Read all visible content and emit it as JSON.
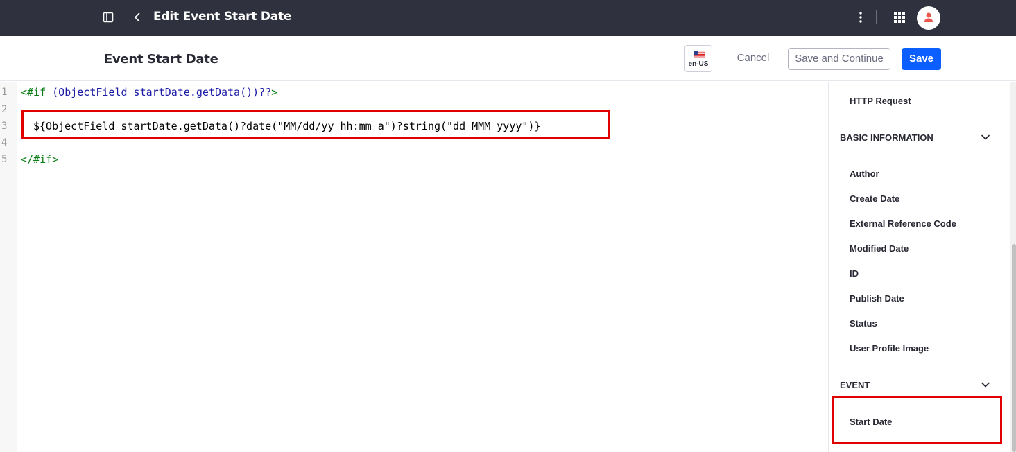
{
  "topbar": {
    "title": "Edit Event Start Date",
    "icons": [
      "sidebar-toggle-icon",
      "chevron-left-icon",
      "kebab-icon",
      "apps-grid-icon",
      "user-avatar-icon"
    ]
  },
  "header": {
    "page_title": "Event Start Date",
    "language_label": "en-US",
    "cancel_label": "Cancel",
    "save_continue_label": "Save and Continue",
    "save_label": "Save"
  },
  "editor": {
    "line_numbers": [
      "1",
      "2",
      "3",
      "4",
      "5"
    ],
    "lines": {
      "l1_tag": "<#if ",
      "l1_expr": "(ObjectField_startDate.getData())??",
      "l1_close": ">",
      "l3": "${ObjectField_startDate.getData()?date(\"MM/dd/yy hh:mm a\")?string(\"dd MMM yyyy\")}",
      "l5": "</#if>"
    }
  },
  "panel": {
    "http_request": "HTTP Request",
    "basic_information": {
      "heading": "BASIC INFORMATION",
      "items": [
        "Author",
        "Create Date",
        "External Reference Code",
        "Modified Date",
        "ID",
        "Publish Date",
        "Status",
        "User Profile Image"
      ]
    },
    "event": {
      "heading": "EVENT",
      "items": [
        "Start Date"
      ]
    }
  },
  "colors": {
    "topbar_bg": "#30313f",
    "primary": "#0b5fff",
    "highlight": "#e00000"
  }
}
